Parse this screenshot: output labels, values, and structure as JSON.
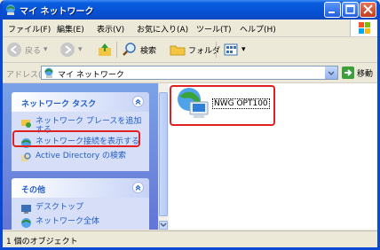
{
  "window": {
    "title": "マイ ネットワーク"
  },
  "menu": [
    "ファイル(F)",
    "編集(E)",
    "表示(V)",
    "お気に入り(A)",
    "ツール(T)",
    "ヘルプ(H)"
  ],
  "toolbar": {
    "back": "戻る",
    "search": "検索",
    "folders": "フォルダ"
  },
  "address": {
    "label": "アドレス(D)",
    "value": "マイ ネットワーク",
    "go": "移動"
  },
  "tasks": {
    "title": "ネットワーク タスク",
    "items": [
      "ネットワーク プレースを追加する",
      "ネットワーク接続を表示する",
      "Active Directory の検索"
    ]
  },
  "other": {
    "title": "その他",
    "items": [
      "デスクトップ",
      "ネットワーク全体"
    ]
  },
  "main": {
    "item_label": "NWG OPT100"
  },
  "status": {
    "text": "1 個のオブジェクト"
  },
  "colors": {
    "title_bar": "#0653d6",
    "highlight": "#e02020",
    "link": "#215dc6"
  }
}
